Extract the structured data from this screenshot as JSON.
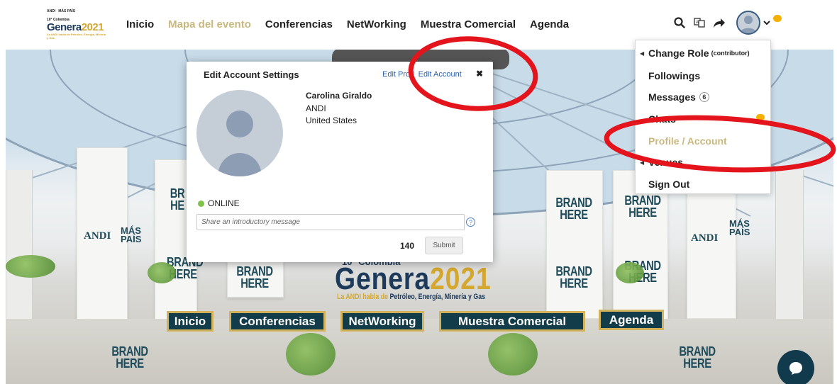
{
  "logo": {
    "small_left": "ANDI",
    "small_right": "MÁS PAÍS",
    "edition": "10° Colombia",
    "name": "Genera",
    "year": "2021",
    "tagline": "La ANDI habla de Petróleo, Energía, Minería y Gas"
  },
  "nav": {
    "items": [
      {
        "label": "Inicio",
        "active": false
      },
      {
        "label": "Mapa del evento",
        "active": true
      },
      {
        "label": "Conferencias",
        "active": false
      },
      {
        "label": "NetWorking",
        "active": false
      },
      {
        "label": "Muestra Comercial",
        "active": false
      },
      {
        "label": "Agenda",
        "active": false
      }
    ],
    "active_color": "#c9b87e"
  },
  "toolbar": {
    "icons": [
      "search-icon",
      "translate-icon",
      "share-icon",
      "avatar",
      "chevron-down-icon",
      "chat-notification-icon"
    ]
  },
  "venue": {
    "brand_text": "BRAND HERE",
    "brand_partial_1": "BR HE",
    "andi": "ANDI",
    "mas_pais": "MÁS PAÍS",
    "banner_edition": "10° Colombia",
    "banner_name": "Genera",
    "banner_year": "2021",
    "banner_tag_prefix": "La ANDI habla de",
    "banner_tag_rest": "Petróleo, Energía, Minería y Gas",
    "buttons": [
      "Inicio",
      "Conferencias",
      "NetWorking",
      "Muestra Comercial",
      "Agenda"
    ],
    "button_bg": "#123c4a",
    "button_border": "#d2b35c"
  },
  "modal": {
    "title": "Edit Account Settings",
    "tabs": [
      "Edit Profi",
      "Edit Account"
    ],
    "close": "✖",
    "user": {
      "name": "Carolina Giraldo",
      "org": "ANDI",
      "country": "United States"
    },
    "status": "ONLINE",
    "intro_placeholder": "Share an introductory message",
    "help": "?",
    "char_count": "140",
    "submit_label": "Submit"
  },
  "dropdown": {
    "items": [
      {
        "label": "Change Role",
        "sub": "(contributor)"
      },
      {
        "label": "Followings"
      },
      {
        "label": "Messages",
        "badge": "6"
      },
      {
        "label": "Chats"
      },
      {
        "label": "Profile / Account"
      },
      {
        "label": "Venues"
      },
      {
        "label": "Sign Out"
      }
    ]
  },
  "annotations": {
    "color": "#e3141b"
  }
}
